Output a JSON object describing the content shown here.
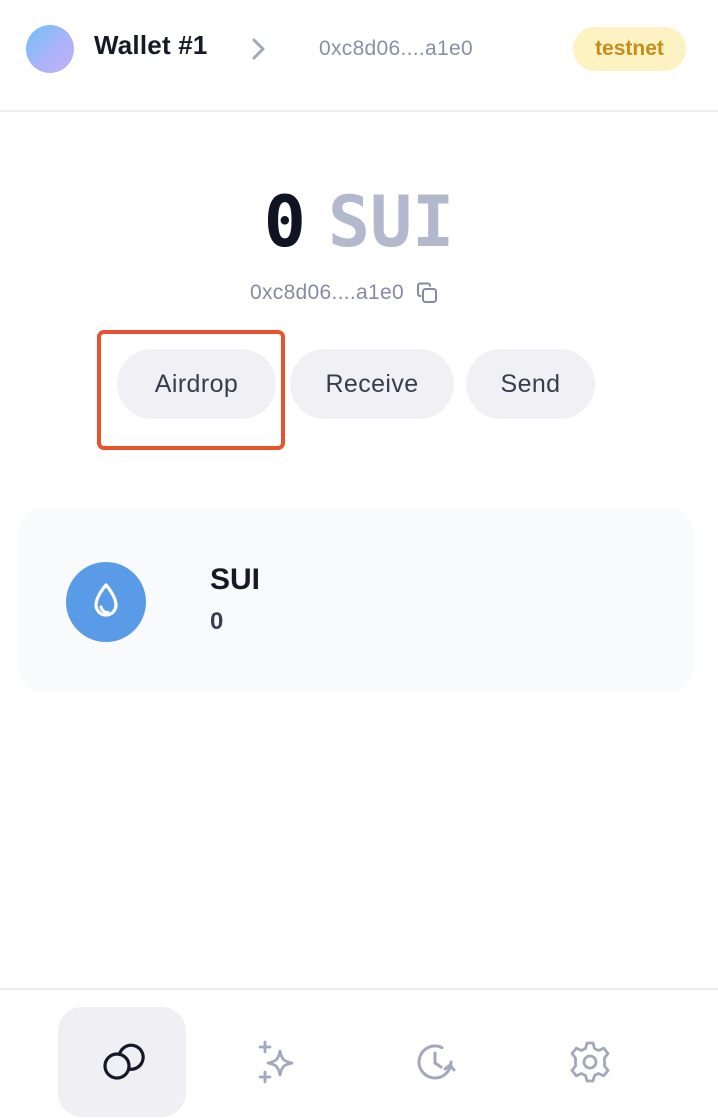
{
  "header": {
    "wallet_name": "Wallet #1",
    "address": "0xc8d06....a1e0",
    "network": "testnet",
    "avatar_colors": [
      "#6ec1f7",
      "#c5b0f7"
    ],
    "badge_color": "#fdf2c2"
  },
  "balance": {
    "amount": "0",
    "symbol": "SUI",
    "address": "0xc8d06....a1e0"
  },
  "actions": {
    "airdrop": "Airdrop",
    "receive": "Receive",
    "send": "Send",
    "highlighted": "airdrop",
    "highlight_color": "#e8532f"
  },
  "coins": [
    {
      "symbol": "SUI",
      "balance": "0",
      "icon": "sui-drop-icon",
      "icon_color": "#5a9be8"
    }
  ],
  "nav": {
    "items": [
      {
        "name": "tokens",
        "icon": "coins-icon",
        "active": true
      },
      {
        "name": "apps",
        "icon": "sparkles-icon",
        "active": false
      },
      {
        "name": "activity",
        "icon": "history-clock-icon",
        "active": false
      },
      {
        "name": "settings",
        "icon": "gear-icon",
        "active": false
      }
    ]
  }
}
